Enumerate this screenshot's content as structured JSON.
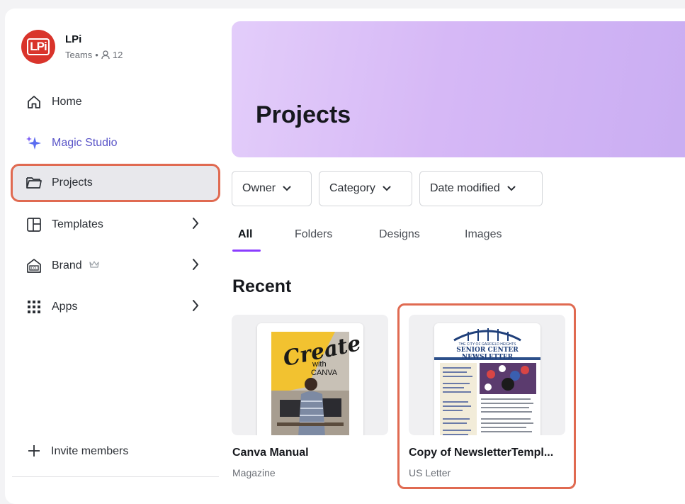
{
  "team": {
    "logo_text": "LPi",
    "name": "LPi",
    "plan": "Teams",
    "members": "12"
  },
  "nav": [
    {
      "label": "Home",
      "icon": "home-icon"
    },
    {
      "label": "Magic Studio",
      "icon": "sparkle-icon"
    },
    {
      "label": "Projects",
      "icon": "folder-icon"
    },
    {
      "label": "Templates",
      "icon": "templates-icon"
    },
    {
      "label": "Brand",
      "icon": "brand-icon"
    },
    {
      "label": "Apps",
      "icon": "apps-grid-icon"
    }
  ],
  "invite_label": "Invite members",
  "main": {
    "title": "Projects",
    "filters": {
      "owner": "Owner",
      "category": "Category",
      "date": "Date modified"
    },
    "tabs": [
      "All",
      "Folders",
      "Designs",
      "Images"
    ],
    "section_title": "Recent",
    "items": [
      {
        "title": "Canva Manual",
        "type": "Magazine",
        "cover_word": "Create",
        "cover_with": "with",
        "cover_brand": "CANVA"
      },
      {
        "title": "Copy of NewsletterTempl...",
        "type": "US Letter",
        "cover_top": "THE CITY OF GARFIELD HEIGHTS",
        "cover_heading": "SENIOR CENTER NEWSLETTER"
      }
    ]
  },
  "colors": {
    "accent": "#8b3dff",
    "highlight": "#e06a51",
    "logo": "#d9342b",
    "magic": "#5a55c8"
  }
}
